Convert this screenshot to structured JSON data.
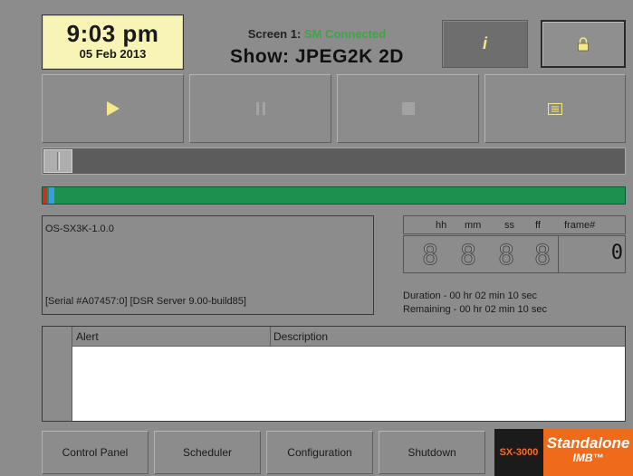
{
  "clock": {
    "time": "9:03 pm",
    "date": "05 Feb 2013"
  },
  "screen": {
    "label": "Screen 1:",
    "status": "SM Connected",
    "status_color": "#3fa445",
    "show": "Show: JPEG2K 2D"
  },
  "header_buttons": {
    "info_icon": "info-icon",
    "info_glyph": "i",
    "lock_icon": "lock-icon"
  },
  "transport": {
    "play_icon": "play-icon",
    "play_color": "#f2e88a",
    "pause_icon": "pause-icon",
    "stop_icon": "stop-icon",
    "list_icon": "list-icon",
    "list_color": "#f2e88a"
  },
  "playback_progress": 0.0,
  "version": {
    "line1": "OS-SX3K-1.0.0",
    "line2": "[Serial #A07457:0] [DSR Server 9.00-build85]"
  },
  "timecode": {
    "headers": [
      "hh",
      "mm",
      "ss",
      "ff",
      "frame#"
    ],
    "digits": [
      "8",
      "8",
      "8",
      "8"
    ],
    "frame": "0"
  },
  "duration": {
    "duration": "Duration  - 00 hr 02 min 10 sec",
    "remaining": "Remaining - 00 hr 02 min 10 sec"
  },
  "alerts": {
    "columns": [
      "Alert",
      "Description"
    ],
    "rows": []
  },
  "bottom_nav": [
    "Control Panel",
    "Scheduler",
    "Configuration",
    "Shutdown"
  ],
  "logo": {
    "model": "SX-3000",
    "brand": "Standalone",
    "sub": "IMB™",
    "brand_color": "#f06a1b"
  }
}
